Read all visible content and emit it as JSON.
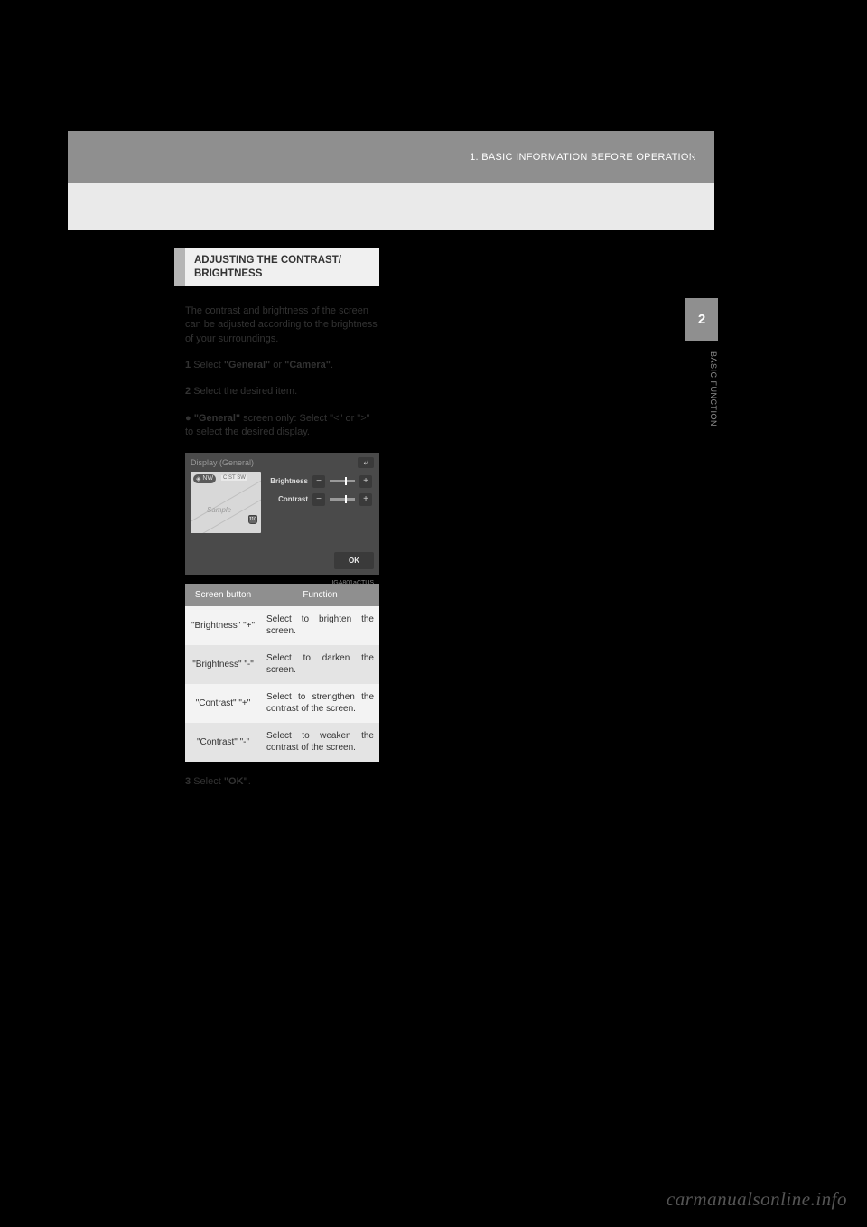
{
  "page_number": "39",
  "header": "1. BASIC INFORMATION BEFORE OPERATION",
  "side_tab": "2",
  "side_text": "BASIC FUNCTION",
  "section_title": "ADJUSTING THE CONTRAST/\nBRIGHTNESS",
  "intro": "The contrast and brightness of the screen can be adjusted according to the brightness of your surroundings.",
  "step1": {
    "num": "1",
    "text_before": "Select ",
    "bold1": "\"General\"",
    "text_mid": " or ",
    "bold2": "\"Camera\"",
    "text_after": "."
  },
  "step2": {
    "num": "2",
    "text": "Select the desired item."
  },
  "step2a": {
    "text_before": "\"General\"",
    "text_after": " screen only: Select \"<\" or \">\" to select the desired display."
  },
  "screenshot": {
    "title": "Display (General)",
    "map_compass": "NW",
    "map_street": "C ST SW",
    "map_sample": "Sample",
    "map_shield": "110",
    "row1_label": "Brightness",
    "row2_label": "Contrast",
    "minus": "−",
    "plus": "+",
    "ok": "OK",
    "back": "⤶",
    "code": "IGA801aCTUS"
  },
  "table": {
    "header1": "Screen button",
    "header2": "Function",
    "rows": [
      {
        "button": "\"Brightness\" \"+\"",
        "func": "Select to brighten the screen."
      },
      {
        "button": "\"Brightness\" \"-\"",
        "func": "Select to darken the screen."
      },
      {
        "button": "\"Contrast\" \"+\"",
        "func": "Select to strengthen the contrast of the screen."
      },
      {
        "button": "\"Contrast\" \"-\"",
        "func": "Select to weaken the contrast of the screen."
      }
    ]
  },
  "step3": {
    "num": "3",
    "text_before": "Select ",
    "bold": "\"OK\"",
    "text_after": "."
  },
  "watermark": "carmanualsonline.info"
}
